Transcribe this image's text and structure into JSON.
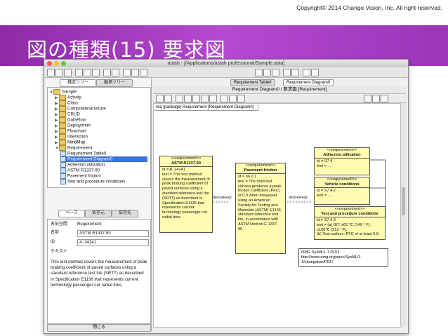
{
  "slide": {
    "copyright": "Copyright© 2014 Change Vision, Inc. All right reserved.",
    "title": "図の種類(15) 要求図"
  },
  "window": {
    "title": "astah - [/Applications/astah professional/Sample.asta]"
  },
  "left_panel": {
    "tabs": [
      "構造ツリー",
      "継承ツリー"
    ],
    "tree": [
      {
        "label": "Sample",
        "type": "folder",
        "depth": 0,
        "expanded": true
      },
      {
        "label": "Activity",
        "type": "folder",
        "depth": 1
      },
      {
        "label": "Class",
        "type": "folder",
        "depth": 1
      },
      {
        "label": "CompositeStructure",
        "type": "folder",
        "depth": 1
      },
      {
        "label": "CRUD",
        "type": "folder",
        "depth": 1
      },
      {
        "label": "DataFlow",
        "type": "folder",
        "depth": 1
      },
      {
        "label": "Deployment",
        "type": "folder",
        "depth": 1
      },
      {
        "label": "Flowchart",
        "type": "folder",
        "depth": 1
      },
      {
        "label": "Interaction",
        "type": "folder",
        "depth": 1
      },
      {
        "label": "MindMap",
        "type": "folder",
        "depth": 1
      },
      {
        "label": "Requirement",
        "type": "folder",
        "depth": 1,
        "expanded": true
      },
      {
        "label": "Requirement Table0",
        "type": "doc",
        "depth": 2
      },
      {
        "label": "Requirement Diagram0",
        "type": "doc",
        "depth": 2,
        "selected": true
      },
      {
        "label": "Adhesion utilization",
        "type": "doc",
        "depth": 2
      },
      {
        "label": "ASTM R1337-90",
        "type": "doc",
        "depth": 2
      },
      {
        "label": "Pavement friction",
        "type": "doc",
        "depth": 2
      },
      {
        "label": "Test and procedure conditions",
        "type": "doc",
        "depth": 2
      }
    ],
    "prop_tabs": [
      "ベース",
      "依存元",
      "依存先"
    ],
    "props": {
      "name_label": "名前空間",
      "name_value": "Requirement",
      "title_label": "名前",
      "title_value": "ASTM R1337-90",
      "id_label": "ID",
      "id_value": "A. 24241",
      "text_label": "テキスト",
      "text_value": "This test method covers the measurement of peak braking coefficient of paved surfaces using a standard reference test tire (SRTT) as described in Specification E1136 that represents current technology passenger car radial tires."
    },
    "close_button": "閉じる"
  },
  "right_panel": {
    "tabs": [
      "Requirement Table0",
      "Requirement Diagram0"
    ],
    "diagram_title": "Requirement Diagram0 / 要求図 [Requirement]",
    "frame_label": "req [package] Requirement [Requirement Diagram0]",
    "requirements": {
      "astm": {
        "stereotype": "<<requirement>>",
        "name": "ASTM R1337-90",
        "id": "id = A. 24241",
        "text": "text = This test method covers the measurement of peak braking coefficient of paved surfaces using a standard reference test tire (SRTT) as described in Specification E1136 that represents current technology passenger car radial tires."
      },
      "pavement": {
        "stereotype": "<<requirement>>",
        "name": "Pavement friction",
        "id": "id = 36.2.1",
        "text": "text = The road test surface produces a peak friction coefficient (PFC) of 0.9 when measured using an American Society for Testing and Materials (ASTM) E1136 standard reference test tire, in accordance with ASTM Method E 1337-90."
      },
      "adhesion": {
        "stereotype": "<<requirement>>",
        "name": "Adhesion utilization",
        "id": "id = S7.4",
        "text": "text = ..."
      },
      "vehicle": {
        "stereotype": "<<requirement>>",
        "name": "Vehicle conditions",
        "id": "id = S7.4.2",
        "text": "text = ..."
      },
      "test": {
        "stereotype": "<<requirement>>",
        "name": "Test and procedure conditions",
        "id": "id = S7.4.3",
        "text1": "text = (a) IBT: ≥65 ℃ (149 ° F), ≤100℃ (212 ° F).",
        "text2": "(b) Test surface: PFC of at least 0.9."
      }
    },
    "note": {
      "line1": "OMG SysML1.1   P152",
      "line2": "http://www.omg.org/spec/SysML/1.",
      "line3": "1/changebar/PDF/"
    },
    "derive_label": "deriveReqt"
  }
}
